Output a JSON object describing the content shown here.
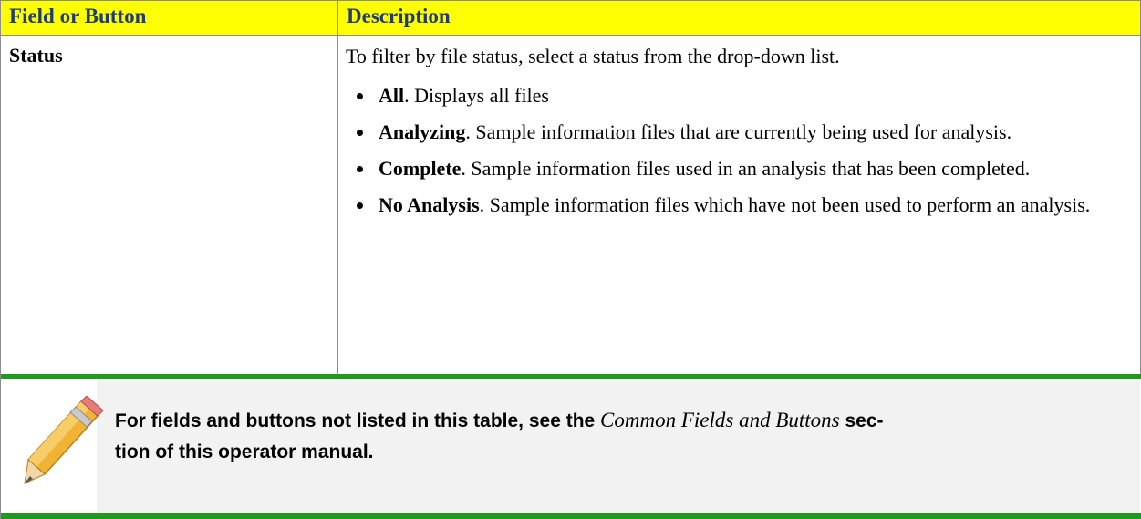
{
  "table": {
    "headers": [
      "Field or Button",
      "Description"
    ],
    "rows": [
      {
        "field": "Status",
        "intro": "To filter by file status, select a status from the drop-down list.",
        "options": [
          {
            "term": "All",
            "text": ". Displays all files"
          },
          {
            "term": "Analyzing",
            "text": ". Sample information files that are currently being used for analysis."
          },
          {
            "term": "Complete",
            "text": ". Sample information files used in an analysis that has been completed."
          },
          {
            "term": "No Analysis",
            "text": ". Sample information files which have not been used to perform an analysis."
          }
        ]
      }
    ]
  },
  "note": {
    "icon": "pencil-icon",
    "text_before": "For fields and buttons not listed in this table, see the ",
    "text_link": "Common Fields and Buttons",
    "text_after_1": " sec-",
    "text_after_2": "tion of this operator manual."
  },
  "colors": {
    "header_background": "#ffff00",
    "header_text": "#1f3b7a",
    "note_bar": "#1f9a1f",
    "note_panel": "#f2f2f2"
  }
}
